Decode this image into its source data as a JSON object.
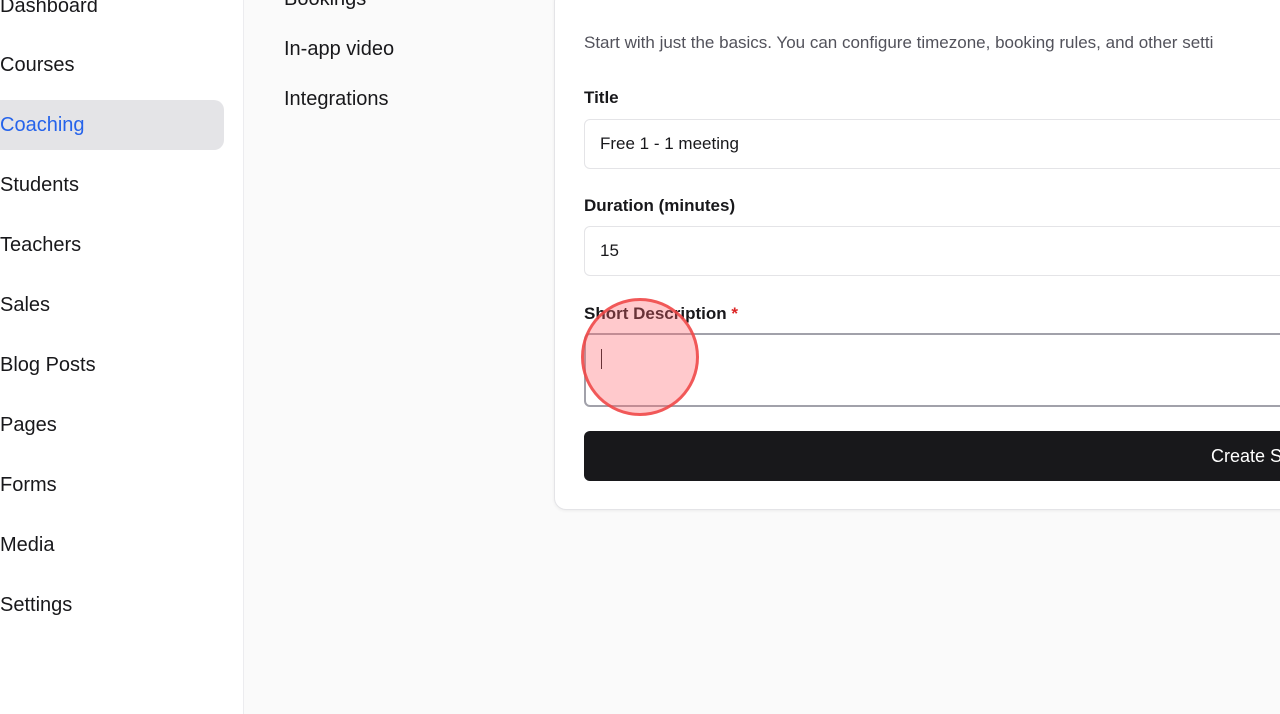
{
  "sidebar": {
    "items": [
      {
        "label": "Dashboard"
      },
      {
        "label": "Courses"
      },
      {
        "label": "Coaching"
      },
      {
        "label": "Students"
      },
      {
        "label": "Teachers"
      },
      {
        "label": "Sales"
      },
      {
        "label": "Blog Posts"
      },
      {
        "label": "Pages"
      },
      {
        "label": "Forms"
      },
      {
        "label": "Media"
      },
      {
        "label": "Settings"
      }
    ],
    "active_item": "Coaching"
  },
  "subnav": {
    "items": [
      {
        "label": "Bookings"
      },
      {
        "label": "In-app video"
      },
      {
        "label": "Integrations"
      }
    ]
  },
  "form": {
    "intro": "Start with just the basics. You can configure timezone, booking rules, and other setti",
    "title_label": "Title",
    "title_value": "Free 1 - 1 meeting",
    "duration_label": "Duration (minutes)",
    "duration_value": "15",
    "description_label": "Short Description",
    "description_required_mark": "*",
    "description_value": "",
    "submit_label": "Create S"
  },
  "colors": {
    "accent": "#2563eb",
    "active_bg": "#e4e4e7",
    "button_bg": "#18181b",
    "required": "#dc2626",
    "click_marker": "#ef4444"
  }
}
